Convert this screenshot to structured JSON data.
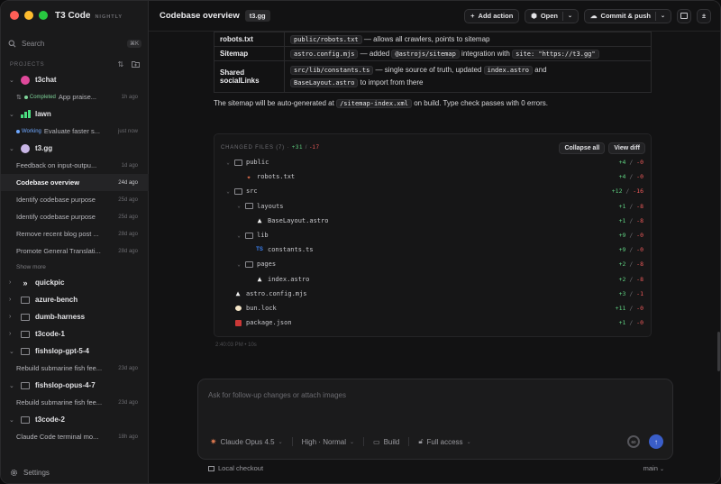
{
  "app": {
    "name": "T3 Code",
    "badge": "NIGHTLY"
  },
  "sidebar": {
    "search": {
      "label": "Search",
      "shortcut": "⌘K"
    },
    "projects_heading": "PROJECTS",
    "projects": [
      {
        "name": "t3chat",
        "icon": "t3chat-avatar-icon",
        "expanded": true,
        "threads": [
          {
            "status": "Completed",
            "title": "App praise...",
            "age": "1h ago",
            "pr": true
          }
        ]
      },
      {
        "name": "lawn",
        "icon": "lawn-chart-icon",
        "expanded": true,
        "threads": [
          {
            "status": "Working",
            "title": "Evaluate faster s...",
            "age": "just now"
          }
        ]
      },
      {
        "name": "t3.gg",
        "icon": "t3gg-avatar-icon",
        "expanded": true,
        "threads": [
          {
            "title": "Feedback on input-outpu...",
            "age": "1d ago"
          },
          {
            "title": "Codebase overview",
            "age": "24d ago",
            "active": true
          },
          {
            "title": "Identify codebase purpose",
            "age": "25d ago"
          },
          {
            "title": "Identify codebase purpose",
            "age": "25d ago"
          },
          {
            "title": "Remove recent blog post ...",
            "age": "28d ago"
          },
          {
            "title": "Promote General Translati...",
            "age": "28d ago"
          }
        ],
        "show_more": "Show more"
      },
      {
        "name": "quickpic",
        "icon": "quickpic-chevrons-icon",
        "expanded": false,
        "threads": []
      },
      {
        "name": "azure-bench",
        "icon": "folder-icon",
        "expanded": false,
        "threads": []
      },
      {
        "name": "dumb-harness",
        "icon": "folder-icon",
        "expanded": false,
        "threads": []
      },
      {
        "name": "t3code-1",
        "icon": "folder-icon",
        "expanded": false,
        "threads": []
      },
      {
        "name": "fishslop-gpt-5-4",
        "icon": "folder-icon",
        "expanded": true,
        "threads": [
          {
            "title": "Rebuild submarine fish fee...",
            "age": "23d ago"
          }
        ]
      },
      {
        "name": "fishslop-opus-4-7",
        "icon": "folder-icon",
        "expanded": true,
        "threads": [
          {
            "title": "Rebuild submarine fish fee...",
            "age": "23d ago"
          }
        ]
      },
      {
        "name": "t3code-2",
        "icon": "folder-icon",
        "expanded": true,
        "threads": [
          {
            "title": "Claude Code terminal mo...",
            "age": "18h ago"
          }
        ]
      }
    ],
    "settings_label": "Settings"
  },
  "header": {
    "title": "Codebase overview",
    "project_chip": "t3.gg",
    "add_action": "Add action",
    "open": "Open",
    "commit_push": "Commit & push"
  },
  "table": {
    "rows": [
      {
        "key": "robots.txt",
        "code1": "public/robots.txt",
        "text1": "— allows all crawlers, points to sitemap"
      },
      {
        "key": "Sitemap",
        "code1": "astro.config.mjs",
        "text1": "— added",
        "code2": "@astrojs/sitemap",
        "text2": "integration with",
        "code3": "site: \"https://t3.gg\""
      },
      {
        "key": "Shared socialLinks",
        "code1": "src/lib/constants.ts",
        "text1": "— single source of truth, updated",
        "code2": "index.astro",
        "text2": "and",
        "code3": "BaseLayout.astro",
        "text3": "to import from there"
      }
    ]
  },
  "message": {
    "before": "The sitemap will be auto-generated at",
    "code": "/sitemap-index.xml",
    "after": "on build. Type check passes with 0 errors."
  },
  "changed_files": {
    "label": "CHANGED FILES (7)",
    "sep": "·",
    "plus": "+31",
    "slash": "/",
    "minus": "-17",
    "collapse_all": "Collapse all",
    "view_diff": "View diff",
    "items": [
      {
        "type": "dir",
        "name": "public",
        "depth": 0,
        "plus": "+4",
        "minus": "-0"
      },
      {
        "type": "file",
        "name": "robots.txt",
        "depth": 1,
        "icon": "robots-file-icon",
        "color": "#e06c4b",
        "plus": "+4",
        "minus": "-0"
      },
      {
        "type": "dir",
        "name": "src",
        "depth": 0,
        "plus": "+12",
        "minus": "-16"
      },
      {
        "type": "dir",
        "name": "layouts",
        "depth": 1,
        "plus": "+1",
        "minus": "-8"
      },
      {
        "type": "file",
        "name": "BaseLayout.astro",
        "depth": 2,
        "icon": "astro-file-icon",
        "color": "#f2f2f2",
        "plus": "+1",
        "minus": "-8"
      },
      {
        "type": "dir",
        "name": "lib",
        "depth": 1,
        "plus": "+9",
        "minus": "-0"
      },
      {
        "type": "file",
        "name": "constants.ts",
        "depth": 2,
        "icon": "typescript-file-icon",
        "color": "#3b82f6",
        "plus": "+9",
        "minus": "-0"
      },
      {
        "type": "dir",
        "name": "pages",
        "depth": 1,
        "plus": "+2",
        "minus": "-8"
      },
      {
        "type": "file",
        "name": "index.astro",
        "depth": 2,
        "icon": "astro-file-icon",
        "color": "#f2f2f2",
        "plus": "+2",
        "minus": "-8"
      },
      {
        "type": "file",
        "name": "astro.config.mjs",
        "depth": 0,
        "icon": "astro-file-icon",
        "color": "#f2f2f2",
        "plus": "+3",
        "minus": "-1"
      },
      {
        "type": "file",
        "name": "bun.lock",
        "depth": 0,
        "icon": "bun-file-icon",
        "color": "#f5e6c8",
        "plus": "+11",
        "minus": "-0"
      },
      {
        "type": "file",
        "name": "package.json",
        "depth": 0,
        "icon": "npm-file-icon",
        "color": "#cb3837",
        "plus": "+1",
        "minus": "-0"
      }
    ],
    "timestamp": "2:40:03 PM • 10s"
  },
  "composer": {
    "placeholder": "Ask for follow-up changes or attach images",
    "model": "Claude Opus 4.5",
    "effort": "High · Normal",
    "mode": "Build",
    "access": "Full access",
    "context_percent": "60"
  },
  "footer": {
    "checkout": "Local checkout",
    "branch": "main"
  },
  "colors": {
    "accent": "#3a5ec9",
    "plus": "#5fcf80",
    "minus": "#ef5a5a",
    "working": "#6fa8ff",
    "completed": "#7fd49a"
  }
}
